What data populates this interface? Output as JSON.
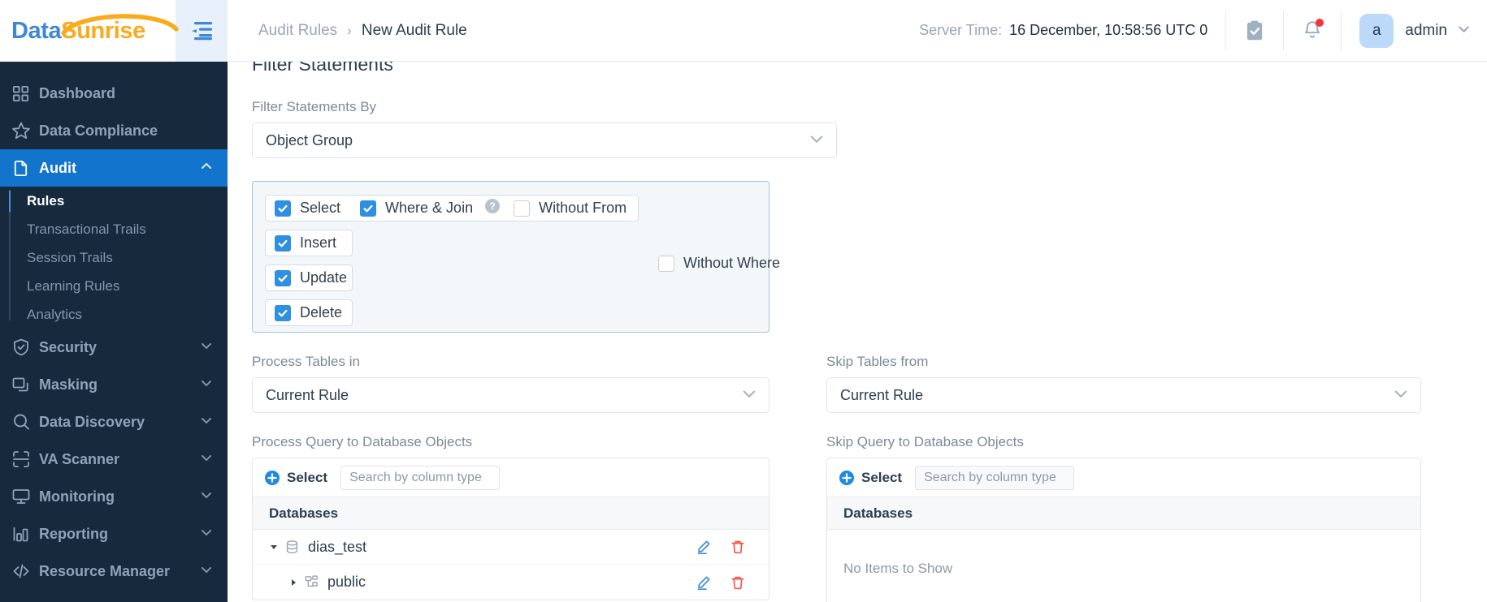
{
  "brand": {
    "name_part1": "Data",
    "name_part2": "Sunrise"
  },
  "sidebar": {
    "items": [
      {
        "label": "Dashboard",
        "icon": "grid-icon",
        "expandable": false
      },
      {
        "label": "Data Compliance",
        "icon": "star-icon",
        "expandable": false
      },
      {
        "label": "Audit",
        "icon": "document-icon",
        "expandable": true,
        "expanded": true,
        "active": true
      },
      {
        "label": "Security",
        "icon": "shield-check-icon",
        "expandable": true
      },
      {
        "label": "Masking",
        "icon": "layers-icon",
        "expandable": true
      },
      {
        "label": "Data Discovery",
        "icon": "search-icon",
        "expandable": true
      },
      {
        "label": "VA Scanner",
        "icon": "scan-icon",
        "expandable": true
      },
      {
        "label": "Monitoring",
        "icon": "monitor-icon",
        "expandable": true
      },
      {
        "label": "Reporting",
        "icon": "bar-chart-icon",
        "expandable": true
      },
      {
        "label": "Resource Manager",
        "icon": "code-icon",
        "expandable": true
      }
    ],
    "audit_subitems": [
      {
        "label": "Rules",
        "current": true
      },
      {
        "label": "Transactional Trails",
        "current": false
      },
      {
        "label": "Session Trails",
        "current": false
      },
      {
        "label": "Learning Rules",
        "current": false
      },
      {
        "label": "Analytics",
        "current": false
      }
    ]
  },
  "header": {
    "breadcrumb_parent": "Audit Rules",
    "breadcrumb_separator": "›",
    "breadcrumb_current": "New Audit Rule",
    "server_time_label": "Server Time:",
    "server_time_value": "16 December, 10:58:56  UTC 0",
    "user_initial": "a",
    "user_name": "admin"
  },
  "content": {
    "section_title": "Filter Statements",
    "filter_by_label": "Filter Statements By",
    "filter_by_value": "Object Group",
    "statements": {
      "select": {
        "label": "Select",
        "checked": true
      },
      "where_join": {
        "label": "Where & Join",
        "checked": true
      },
      "without_from": {
        "label": "Without From",
        "checked": false
      },
      "insert": {
        "label": "Insert",
        "checked": true
      },
      "update": {
        "label": "Update",
        "checked": true
      },
      "delete": {
        "label": "Delete",
        "checked": true
      },
      "without_where": {
        "label": "Without Where",
        "checked": false
      }
    },
    "process_tables": {
      "label": "Process Tables in",
      "value": "Current Rule"
    },
    "skip_tables": {
      "label": "Skip Tables from",
      "value": "Current Rule"
    },
    "process_objects": {
      "label": "Process Query to Database Objects",
      "select_label": "Select",
      "search_placeholder": "Search by column type",
      "column_header": "Databases",
      "rows": [
        {
          "name": "dias_test",
          "icon": "database-icon",
          "level": 0,
          "expanded": true
        },
        {
          "name": "public",
          "icon": "schema-icon",
          "level": 1,
          "expanded": false
        }
      ]
    },
    "skip_objects": {
      "label": "Skip Query to Database Objects",
      "select_label": "Select",
      "search_placeholder": "Search by column type",
      "column_header": "Databases",
      "empty_text": "No Items to Show"
    }
  },
  "colors": {
    "sidebar_bg": "#16293d",
    "active_blue": "#1274cc",
    "accent_blue": "#2f8fe0",
    "brand_orange": "#f9ab1c",
    "danger_red": "#f4554a",
    "notification_red": "#f5333f"
  }
}
